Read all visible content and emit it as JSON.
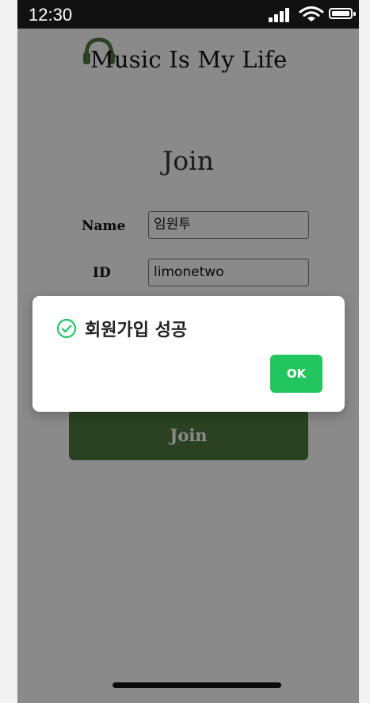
{
  "status_bar": {
    "time": "12:30"
  },
  "header": {
    "logo_text": "Music Is My Life"
  },
  "form": {
    "title": "Join",
    "name_label": "Name",
    "name_value": "임원투",
    "id_label": "ID",
    "id_value": "limonetwo",
    "submit_label": "Join"
  },
  "dialog": {
    "message": "회원가입 성공",
    "ok_label": "OK"
  },
  "colors": {
    "accent_green": "#4f7a3f",
    "ok_button": "#22c55e",
    "success_icon": "#22c55e"
  }
}
